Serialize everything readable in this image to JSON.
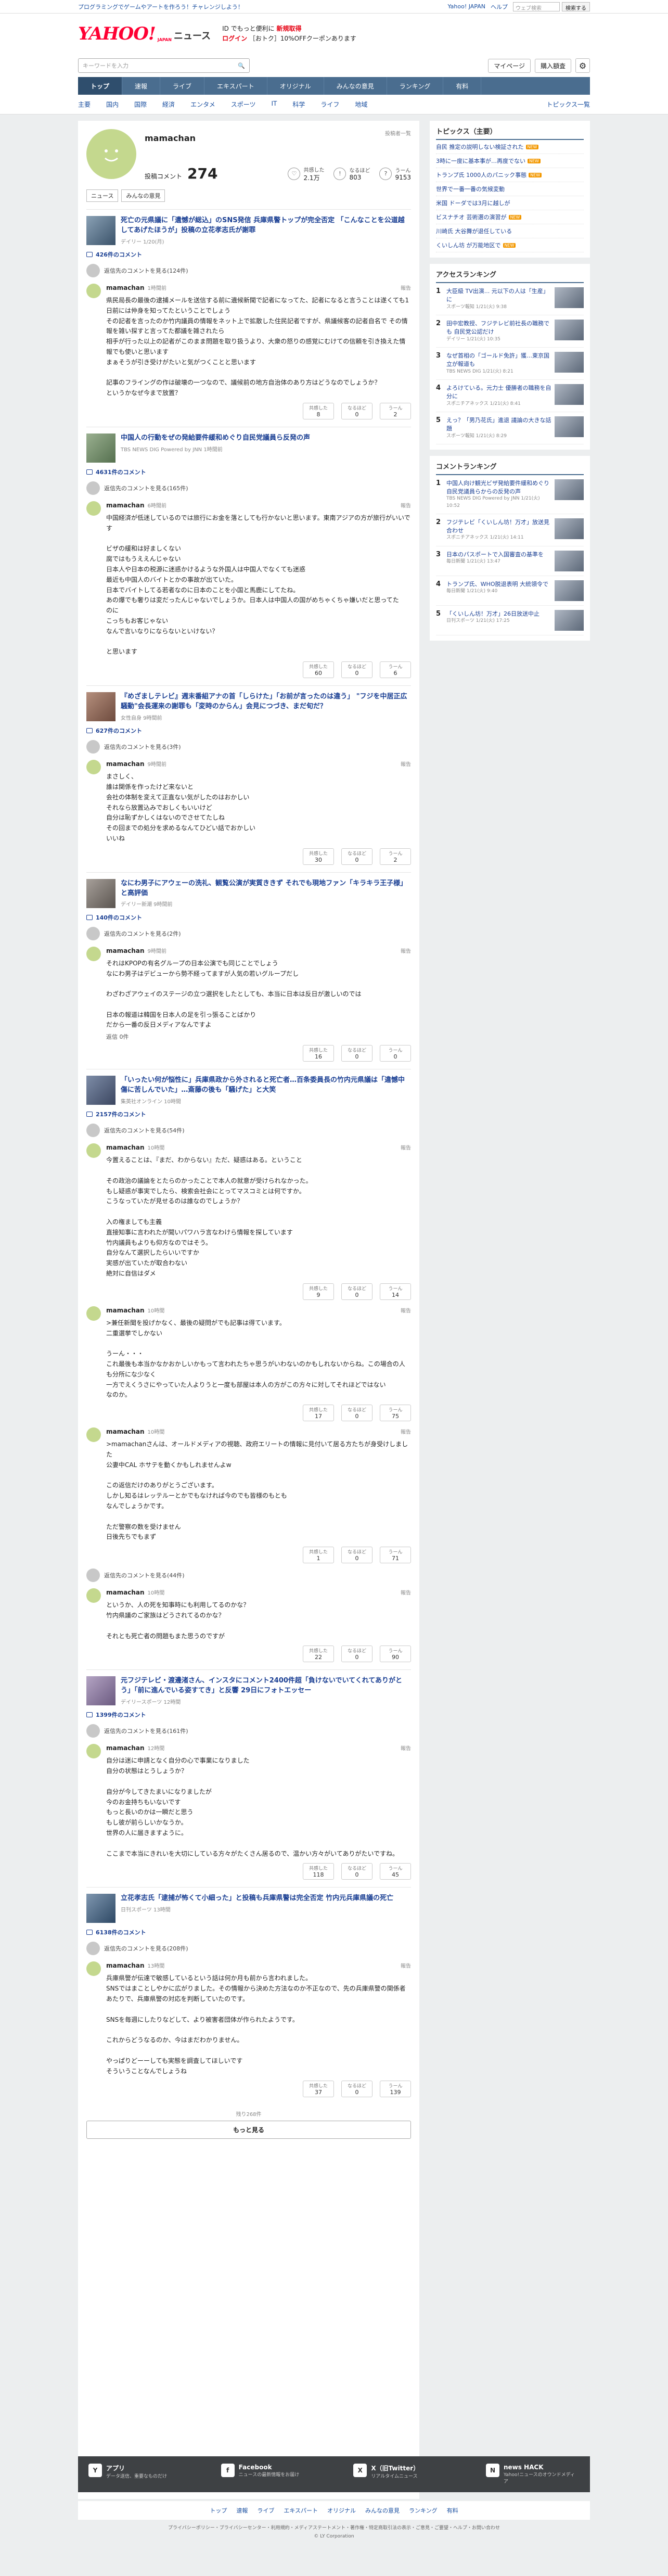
{
  "top_strip": {
    "promo": "プログラミングでゲームやアートを作ろう！チャレンジしよう！",
    "links": [
      "Yahoo! JAPAN",
      "ヘルプ"
    ],
    "search_placeholder": "ウェブ検索",
    "search_button": "検索する"
  },
  "header": {
    "logo": "YAHOO!",
    "logo_sub": "JAPAN",
    "section": "ニュース",
    "promo_line1": "ID でもっと便利に",
    "promo_line1_red": "新規取得",
    "promo_line2": "ログイン",
    "promo_line2_rest": "［おトク］10%OFFクーポンあります"
  },
  "search": {
    "placeholder": "キーワードを入力",
    "mypage": "マイページ",
    "register": "購入額査"
  },
  "primary_nav": [
    "トップ",
    "速報",
    "ライブ",
    "エキスパート",
    "オリジナル",
    "みんなの意見",
    "ランキング",
    "有料"
  ],
  "sub_nav": {
    "items": [
      "主要",
      "国内",
      "国際",
      "経済",
      "エンタメ",
      "スポーツ",
      "IT",
      "科学",
      "ライフ",
      "地域"
    ],
    "right": "トピックス一覧"
  },
  "profile": {
    "name": "mamachan",
    "history_link": "投稿者一覧",
    "posted_label": "投稿コメント",
    "posted_count": "274",
    "reactions": [
      {
        "label": "共感した",
        "value": "2.1万",
        "icon": "♡"
      },
      {
        "label": "なるほど",
        "value": "803",
        "icon": "!"
      },
      {
        "label": "うーん",
        "value": "9153",
        "icon": "?"
      }
    ],
    "tabs": [
      "ニュース",
      "みんなの意見"
    ]
  },
  "articles": [
    {
      "title": "死亡の元県議に「遺憾が総込」のSNS発信 兵庫県警トップが完全否定 「こんなことを公道越してあげたほうが」投稿の立花孝志氏が謝罪",
      "source": "デイリー 1/20(月)",
      "count": "426件のコメント",
      "see": "返信先のコメントを見る(124件)",
      "comment": {
        "user": "mamachan",
        "time": "1時間前",
        "report": "報告",
        "text": "県民局長の最後の逮捕メールを送信する前に遺候新聞で記者になってた、記者になると言うことは遂くても1日前には仲身を知ってたということでしょう\nその記者を言ったのか竹内議員の情報をネット上で拡散した住民記者ですが、県議候客の記者自名で その情報を雑い探すと言ってた都議を雑されたら\n相手が行った以上の記者がこのまま問題を取り扱うより、大衆の怒りの感覚にむけての信頼を引き換えた情報でも使いと思います\nまぁそうが引き受けがたいと気がつくことと思います\n\n記事のフライングの作は破壊の一つなので、議候前の地方自治体のあり方はどうなのでしょうか？\nというかなぜ今まで放置？",
        "votes": [
          {
            "label": "共感した",
            "value": "8"
          },
          {
            "label": "なるほど",
            "value": "0"
          },
          {
            "label": "うーん",
            "value": "2"
          }
        ]
      }
    },
    {
      "title": "中国人の行動をぜの発給要件緩和めぐり自民党議員ら反発の声",
      "source": "TBS NEWS DIG Powered by JNN 1時間前",
      "count": "4631件のコメント",
      "see": "返信先のコメントを見る(165件)",
      "comment": {
        "user": "mamachan",
        "time": "6時間前",
        "report": "報告",
        "text": "中国経済が低迷しているのでは旅行にお金を落としても行かないと思います。東南アジアの方が旅行がいいです\n\nビザの緩和は好ましくない\n腐ではもうええんじゃない\n日本人や日本の税源に迷惑かけるような外国人は中国人でなくても迷惑\n最近も中国人のバイトとかの事故が出ていた。\n日本でバイトしてる若者なのに日本のことを小国と馬鹿にしてたね。\nあの爆でも奢りは変だったんじゃないでしょうか。日本人は中国人の国がめちゃくちゃ嫌いだと思ってた\nのに\nこっちもお客じゃない\nなんで言いなりにならないといけない？\n\nと思います",
        "votes": [
          {
            "label": "共感した",
            "value": "60"
          },
          {
            "label": "なるほど",
            "value": "0"
          },
          {
            "label": "うーん",
            "value": "6"
          }
        ]
      }
    },
    {
      "title": "『めざましテレビ』週末番組アナの首「しらけた」「お前が言ったのは違う」 \"フジを中居正広騒動\"会長運来の謝罪も「変時のからん」会見につづき、まだ旬だ？",
      "source": "女性自身 9時間前",
      "count": "627件のコメント",
      "see": "返信先のコメントを見る(3件)",
      "comment": {
        "user": "mamachan",
        "time": "9時間前",
        "report": "報告",
        "text": "まさしく、\n誰は関係を作ったけど来ないと\n会社の体制を変えて正直ない気がしたのはおかしい\nそれなら放置込みでおしくもいいけど\n自分は恥ずかしくはないのでさせてたしね\nその回までの処分を求めるなんてひどい話でおかしい\nいいね",
        "votes": [
          {
            "label": "共感した",
            "value": "30"
          },
          {
            "label": "なるほど",
            "value": "0"
          },
          {
            "label": "うーん",
            "value": "2"
          }
        ]
      }
    },
    {
      "title": "なにわ男子にアウェーの洗礼、観覧公演が実質ききず それでも現地ファン「キラキラ王子様」と高評価",
      "source": "デイリー新潮 9時間前",
      "count": "140件のコメント",
      "see": "返信先のコメントを見る(2件)",
      "comment": {
        "user": "mamachan",
        "time": "9時間前",
        "report": "報告",
        "text": "それはKPOPの有名グループの日本公演でも同じことでしょう\nなにわ男子はデビューから勢不経ってますが人気の若いグループだし\n\nわざわざアウェイのステージの立つ選択をしたとしても、本当に日本は反日が激しいのでは\n\n日本の報道は韓国を日本人の足を引っ張ることばかり\nだから一番の反日メディアなんですよ",
        "reply": "返信 0件",
        "votes": [
          {
            "label": "共感した",
            "value": "16"
          },
          {
            "label": "なるほど",
            "value": "0"
          },
          {
            "label": "うーん",
            "value": "0"
          }
        ]
      }
    },
    {
      "title": "「いったい何が悩性に」兵庫県政から外されると死亡者…百条委員長の竹内元県議は「違憾中傷に苦しんでいた」…斎藤の後も「騒げた」と大笑",
      "source": "集英社オンライン 10時間",
      "count": "2157件のコメント",
      "see": "返信先のコメントを見る(54件)",
      "comments": [
        {
          "user": "mamachan",
          "time": "10時間",
          "report": "報告",
          "text": "今置えることは、『まだ、わからない』ただ、疑惑はある。ということ\n\nその政治の議論をとたらのかったことで本人の就意が受けられなかった。\nもし疑惑が事実でしたら、検索会社会にとってマスコミとは何ですか。\nこうなっていたが見せるのは誰なのでしょうか？\n\n入の権ましても主義\n直接知事に言われたが聞いパワハラ言なわけら情報を探しています\n竹内議員もよりも仰方なのではそう。\n自分なんて選択したらいいですか\n実感が出ていたが取合わない\n絶対に自信はダメ",
          "votes": [
            {
              "label": "共感した",
              "value": "9"
            },
            {
              "label": "なるほど",
              "value": "0"
            },
            {
              "label": "うーん",
              "value": "14"
            }
          ]
        },
        {
          "user": "mamachan",
          "time": "10時間",
          "report": "報告",
          "text": ">兼任新聞を投げかなく、最後の疑問がでも記事は得ています。\n二重選挙でしかない\n\nうーん・・・\nこれ最後も本当かなかおかしいかもって言われたちゃ思うがいわないのかもしれないからね。この場合の人も分所にな少なく\n一方でえくうさにやっていた人よりうと一度も部屋は本人の方がこの方々に対してそれほどではない\nなのか。",
          "votes": [
            {
              "label": "共感した",
              "value": "17"
            },
            {
              "label": "なるほど",
              "value": "0"
            },
            {
              "label": "うーん",
              "value": "75"
            }
          ]
        },
        {
          "user": "mamachan",
          "time": "10時間",
          "report": "報告",
          "text": ">mamachanさんは、オールドメディアの視聴、政府エリートの情報に見付いて居る方たちが身受けしました\n公妻中CAL ホサテを動くかもしれませんよw\n\nこの返信だけのありがとうございます。\nしかし知るはレッテルーとかでもなければ今のでも皆様のもとも\nなんでしょうかです。\n\nただ警察の数を受けません\n日後先ちでもまず",
          "votes": [
            {
              "label": "共感した",
              "value": "1"
            },
            {
              "label": "なるほど",
              "value": "0"
            },
            {
              "label": "うーん",
              "value": "71"
            }
          ]
        }
      ],
      "see2": "返信先のコメントを見る(44件)",
      "comment2": {
        "user": "mamachan",
        "time": "10時間",
        "report": "報告",
        "text": "というか、人の死を知事時にも利用してるのかな？\n竹内県議のご家族はどうされてるのかな？\n\nそれとも死亡者の問題もまた思うのですが",
        "votes": [
          {
            "label": "共感した",
            "value": "22"
          },
          {
            "label": "なるほど",
            "value": "0"
          },
          {
            "label": "うーん",
            "value": "90"
          }
        ]
      }
    },
    {
      "title": "元フジテレビ・渡邊渚さん、インスタにコメント2400件超「負けないでいてくれてありがとう」「前に進んでいる姿すてき」と反響 29日にフォトエッセー",
      "source": "デイリースポーツ 12時間",
      "count": "1399件のコメント",
      "see": "返信先のコメントを見る(161件)",
      "comment": {
        "user": "mamachan",
        "time": "12時間",
        "report": "報告",
        "text": "自分は迷に申請となく自分の心で事業になりました\n自分の状態はとうしょうか？\n\n自分が今してきたまいになりましたが\n今のお金持ちもいないです\nもっと長いのかは一瞬だと思う\nもし彼が前らしいかなうか。\n世界の人に届きますように。\n\nここまで本当にきれいを大切にしている方々がたくさん居るので、温かい方々がいてありがたいですね。",
        "votes": [
          {
            "label": "共感した",
            "value": "118"
          },
          {
            "label": "なるほど",
            "value": "0"
          },
          {
            "label": "うーん",
            "value": "45"
          }
        ]
      }
    },
    {
      "title": "立花孝志氏「逮捕が怖くて小細った」と投稿も兵庫県警は完全否定 竹内元兵庫県議の死亡",
      "source": "日刊スポーツ 13時間",
      "count": "6138件のコメント",
      "see": "返信先のコメントを見る(208件)",
      "comment": {
        "user": "mamachan",
        "time": "13時間",
        "report": "報告",
        "text": "兵庫県警が伝達で敏感しているという話は何か月も前から言われました。\nSNSではまことしやかに広がりました。その情報から決めた方法なのか不正なので、先の兵庫県警の関係者あたりで、兵庫県警の対応を判断していたのです。\n\nSNSを毎週にしたりなどして、より被害者団体が作られたようです。\n\nこれからどうなるのか、今はまだわかりません。\n\nやっぱりどーーしても実態を調査してほしいです\nそういうことなんでしょうね",
        "votes": [
          {
            "label": "共感した",
            "value": "37"
          },
          {
            "label": "なるほど",
            "value": "0"
          },
          {
            "label": "うーん",
            "value": "139"
          }
        ]
      }
    }
  ],
  "more": {
    "count": "残り268件",
    "label": "もっと見る"
  },
  "sidebar": {
    "topics": {
      "title": "トピックス（主要）",
      "items": [
        {
          "text": "自民 推定の説明しない検証された",
          "badge": "NEW"
        },
        {
          "text": "3時に一度に基本事が…再度でない",
          "badge": "NEW"
        },
        {
          "text": "トランプ氏 1000人のパニック事態",
          "badge": "NEW"
        },
        {
          "text": "世界で一番一番の気候変動",
          "badge": ""
        },
        {
          "text": "米国 ドーダでは3月に越しが",
          "badge": ""
        },
        {
          "text": "ビスナチオ 芸術選の演習が",
          "badge": "NEW"
        },
        {
          "text": "川崎氏 大谷舞が退任している",
          "badge": ""
        },
        {
          "text": "くいしん坊 が万能地区で",
          "badge": "NEW"
        }
      ]
    },
    "access_ranking": {
      "title": "アクセスランキング",
      "items": [
        {
          "rank": "1",
          "text": "大臣級 TV出演... 元以下の人は「生産」に",
          "src": "スポーツ報知 1/21(火) 9:38"
        },
        {
          "rank": "2",
          "text": "田中宏教授、フジテレビ前社長の職務でも 自民党公認だけ",
          "src": "デイリー 1/21(火) 10:35"
        },
        {
          "rank": "3",
          "text": "なぜ首相の「ゴールド免許」獲…東京国立が報道も",
          "src": "TBS NEWS DIG 1/21(火) 8:21"
        },
        {
          "rank": "4",
          "text": "よろけている。元力士 優勝者の職務を自分に",
          "src": "スポニチアネックス 1/21(火) 8:41"
        },
        {
          "rank": "5",
          "text": "えっ？「男乃花氏」進退 議論の大きな話題",
          "src": "スポーツ報知 1/21(火) 8:29"
        }
      ]
    },
    "comment_ranking": {
      "title": "コメントランキング",
      "items": [
        {
          "rank": "1",
          "text": "中国人向け観光ビザ発給要件緩和めぐり自民党議員らからの反発の声",
          "src": "TBS NEWS DIG Powered by JNN 1/21(火) 10:52"
        },
        {
          "rank": "2",
          "text": "フジテレビ「くいしん坊！万才」放送見合わせ",
          "src": "スポニチアネックス 1/21(火) 14:11"
        },
        {
          "rank": "3",
          "text": "日本のパスポートで入国審査の基準を",
          "src": "毎日新聞 1/21(火) 13:47"
        },
        {
          "rank": "4",
          "text": "トランプ氏、WHO脱退表明 大統領令で",
          "src": "毎日新聞 1/21(火) 9:40"
        },
        {
          "rank": "5",
          "text": "「くいしん坊！万才」26日放送中止",
          "src": "日刊スポーツ 1/21(火) 17:25"
        }
      ]
    }
  },
  "footer": {
    "cols": [
      {
        "icon": "Y",
        "title": "アプリ",
        "sub": "データ送信、重要なものだけ"
      },
      {
        "icon": "f",
        "title": "Facebook",
        "sub": "ニュースの最新情報をお届け"
      },
      {
        "icon": "X",
        "title": "X（旧Twitter）",
        "sub": "リアルタイムニュース"
      },
      {
        "icon": "N",
        "title": "news HACK",
        "sub": "Yahoo!ニュースのオウンドメディア"
      }
    ],
    "nav": [
      "トップ",
      "速報",
      "ライブ",
      "エキスパート",
      "オリジナル",
      "みんなの意見",
      "ランキング",
      "有料"
    ],
    "legal1": "プライバシーポリシー・プライバシーセンター・利用規約・メディアステートメント・著作権・特定商取引法の表示・ご意見・ご要望・ヘルプ・お問い合わせ",
    "copyright": "© LY Corporation"
  }
}
